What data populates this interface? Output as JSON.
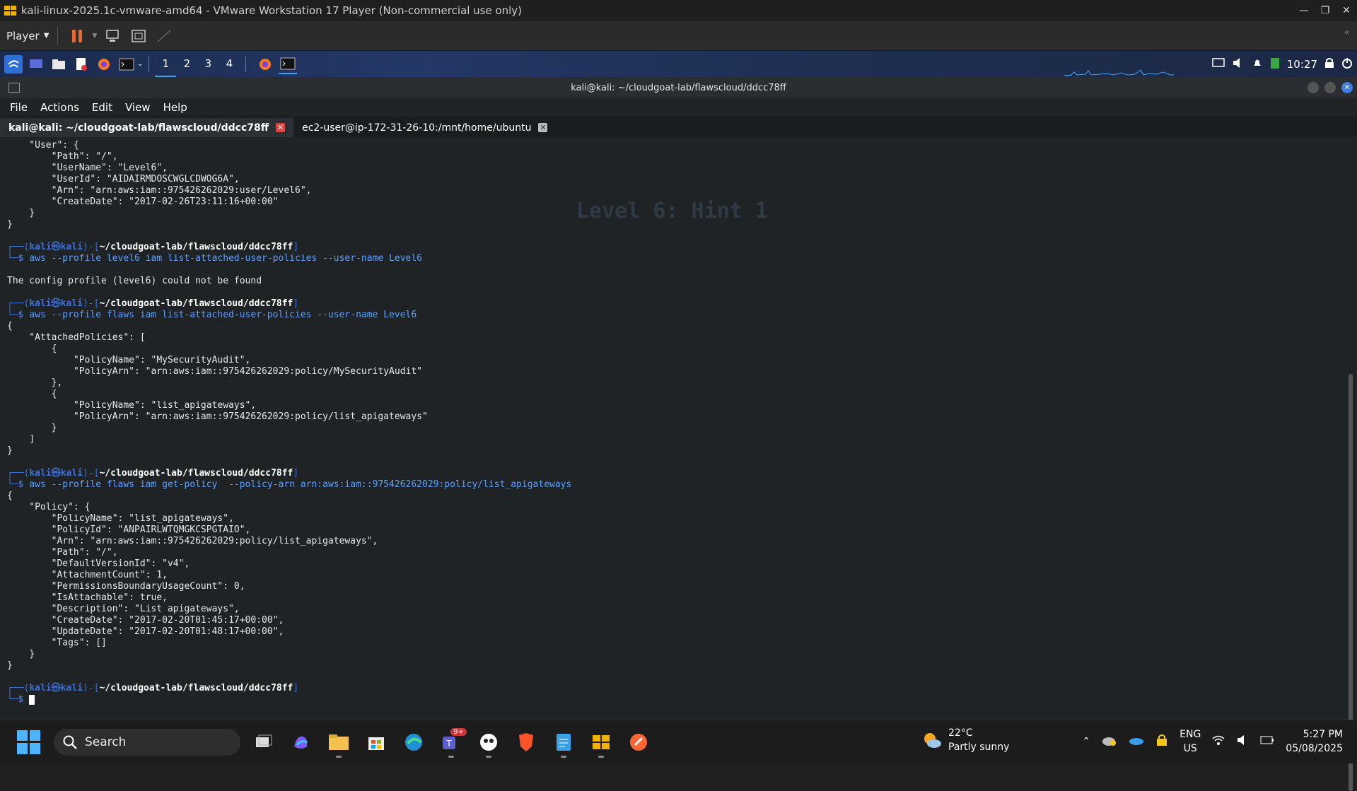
{
  "vm": {
    "title": "kali-linux-2025.1c-vmware-amd64 - VMware Workstation 17 Player (Non-commercial use only)",
    "player_label": "Player"
  },
  "panel": {
    "workspaces": [
      "1",
      "2",
      "3",
      "4"
    ],
    "time": "10:27"
  },
  "terminal": {
    "window_title": "kali@kali: ~/cloudgoat-lab/flawscloud/ddcc78ff",
    "menu": [
      "File",
      "Actions",
      "Edit",
      "View",
      "Help"
    ],
    "tabs": [
      {
        "label": "kali@kali: ~/cloudgoat-lab/flawscloud/ddcc78ff",
        "active": true
      },
      {
        "label": "ec2-user@ip-172-31-26-10:/mnt/home/ubuntu",
        "active": false
      }
    ],
    "prompt": {
      "user": "kali",
      "at": "㉿",
      "host": "kali",
      "path": "~/cloudgoat-lab/flawscloud/ddcc78ff"
    },
    "lines": {
      "l1": "    \"User\": {",
      "l2": "        \"Path\": \"/\",",
      "l3": "        \"UserName\": \"Level6\",",
      "l4": "        \"UserId\": \"AIDAIRMDOSCWGLCDWOG6A\",",
      "l5": "        \"Arn\": \"arn:aws:iam::975426262029:user/Level6\",",
      "l6": "        \"CreateDate\": \"2017-02-26T23:11:16+00:00\"",
      "l7": "    }",
      "l8": "}",
      "cmd1": "aws --profile level6 iam list-attached-user-policies --user-name Level6",
      "err1": "The config profile (level6) could not be found",
      "cmd2": "aws --profile flaws iam list-attached-user-policies --user-name Level6",
      "a1": "{",
      "a2": "    \"AttachedPolicies\": [",
      "a3": "        {",
      "a4": "            \"PolicyName\": \"MySecurityAudit\",",
      "a5": "            \"PolicyArn\": \"arn:aws:iam::975426262029:policy/MySecurityAudit\"",
      "a6": "        },",
      "a7": "        {",
      "a8": "            \"PolicyName\": \"list_apigateways\",",
      "a9": "            \"PolicyArn\": \"arn:aws:iam::975426262029:policy/list_apigateways\"",
      "a10": "        }",
      "a11": "    ]",
      "a12": "}",
      "cmd3": "aws --profile flaws iam get-policy  --policy-arn arn:aws:iam::975426262029:policy/list_apigateways",
      "p1": "{",
      "p2": "    \"Policy\": {",
      "p3": "        \"PolicyName\": \"list_apigateways\",",
      "p4": "        \"PolicyId\": \"ANPAIRLWTQMGKCSPGTAIO\",",
      "p5": "        \"Arn\": \"arn:aws:iam::975426262029:policy/list_apigateways\",",
      "p6": "        \"Path\": \"/\",",
      "p7": "        \"DefaultVersionId\": \"v4\",",
      "p8": "        \"AttachmentCount\": 1,",
      "p9": "        \"PermissionsBoundaryUsageCount\": 0,",
      "p10": "        \"IsAttachable\": true,",
      "p11": "        \"Description\": \"List apigateways\",",
      "p12": "        \"CreateDate\": \"2017-02-20T01:45:17+00:00\",",
      "p13": "        \"UpdateDate\": \"2017-02-20T01:48:17+00:00\",",
      "p14": "        \"Tags\": []",
      "p15": "    }",
      "p16": "}"
    },
    "background_heading": "Level 6: Hint 1"
  },
  "taskbar": {
    "search_placeholder": "Search",
    "weather_temp": "22°C",
    "weather_desc": "Partly sunny",
    "lang1": "ENG",
    "lang2": "US",
    "time": "5:27 PM",
    "date": "05/08/2025",
    "teams_badge": "9+"
  }
}
